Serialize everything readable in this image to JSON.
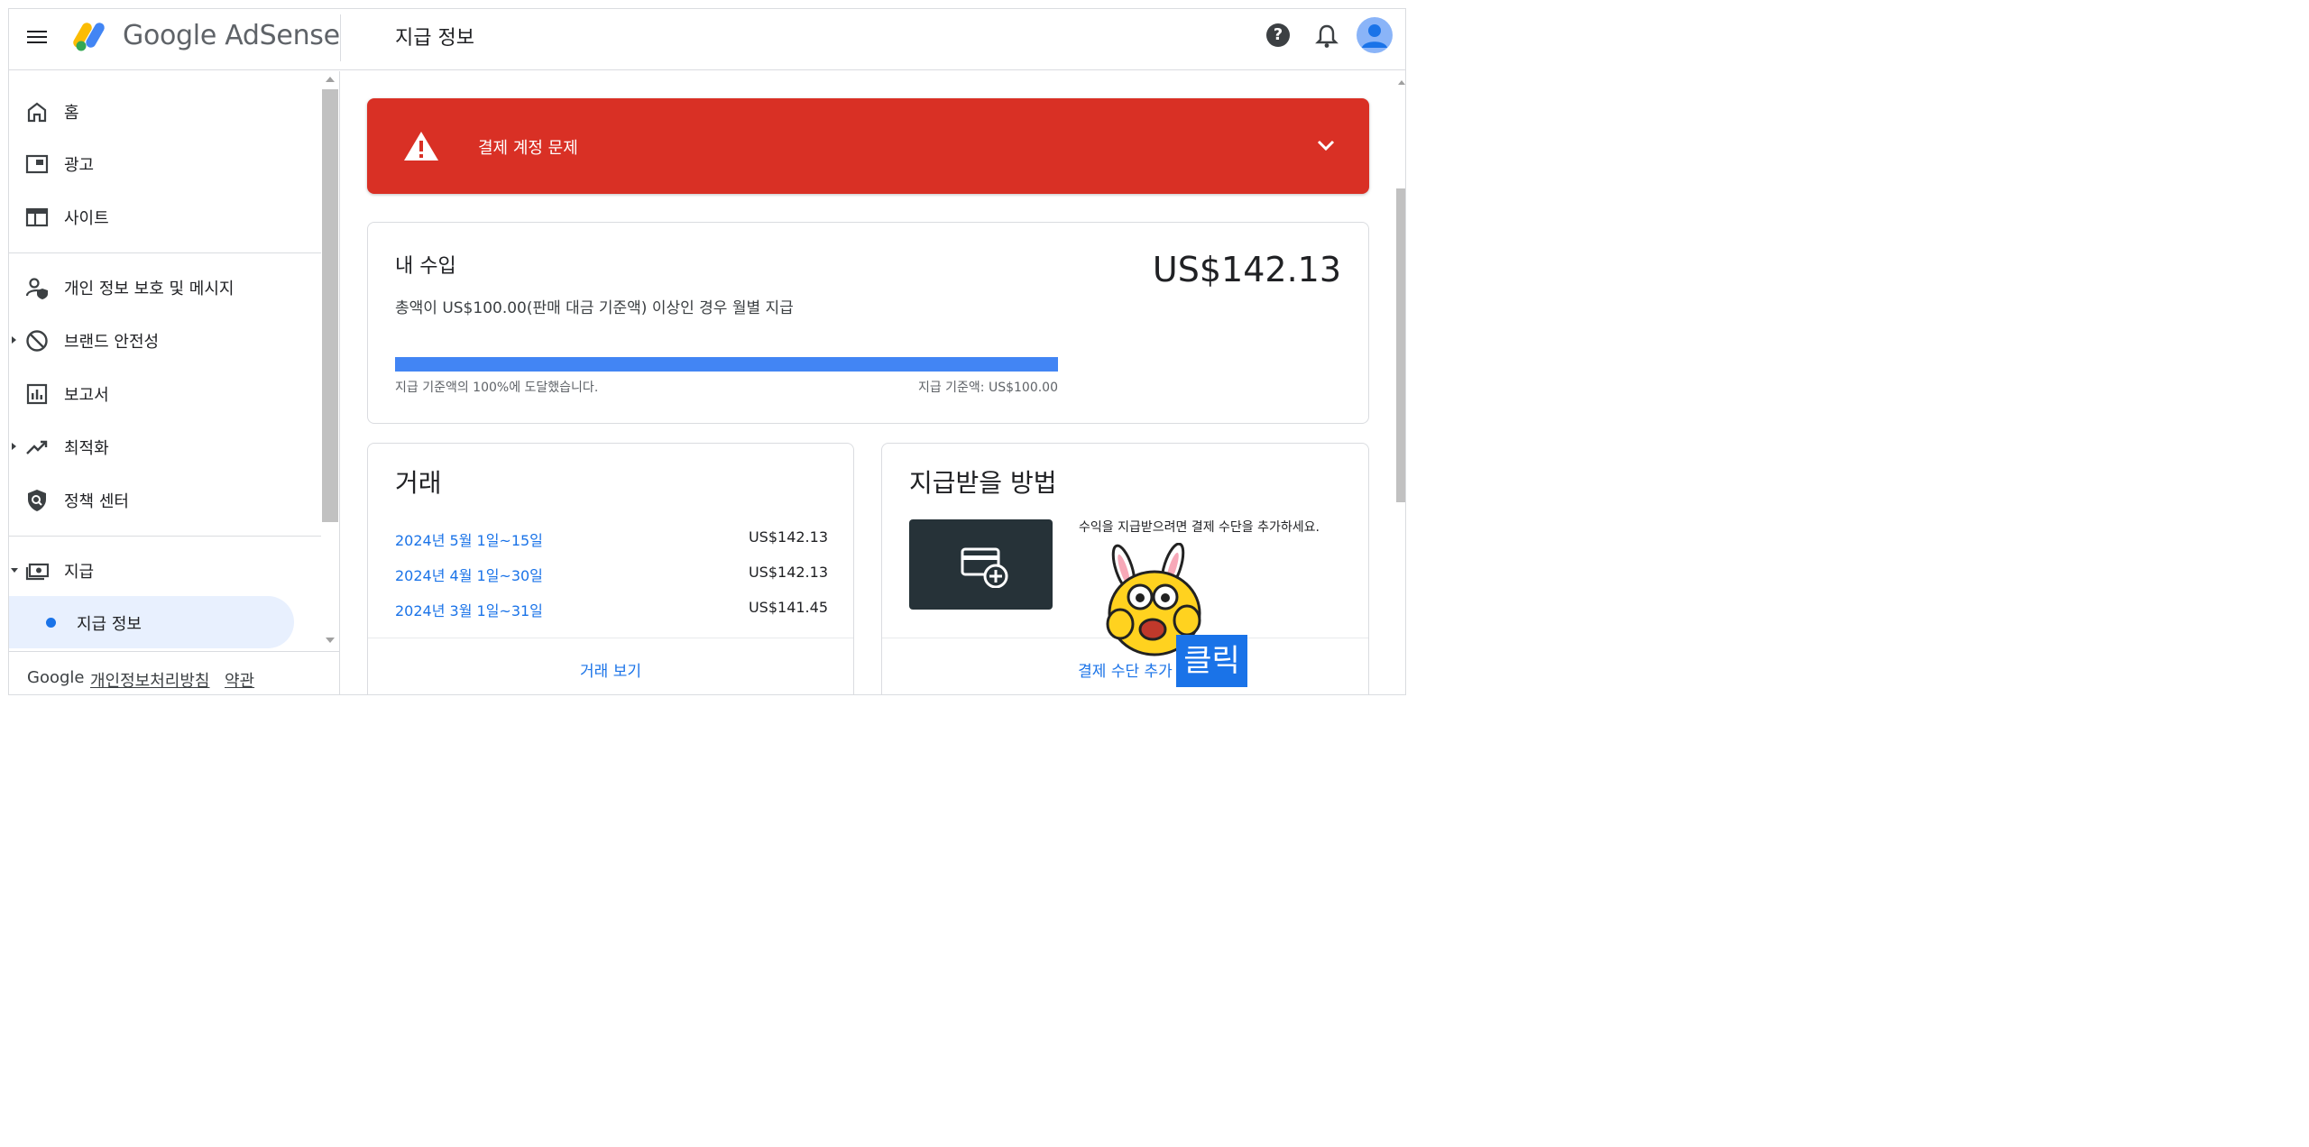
{
  "header": {
    "brand": "Google AdSense",
    "page_title": "지급 정보",
    "help_icon": "?"
  },
  "sidebar": {
    "items": [
      {
        "label": "홈",
        "icon": "home-icon"
      },
      {
        "label": "광고",
        "icon": "ads-icon"
      },
      {
        "label": "사이트",
        "icon": "sites-icon"
      },
      {
        "label": "개인 정보 보호 및 메시지",
        "icon": "privacy-icon"
      },
      {
        "label": "브랜드 안전성",
        "icon": "block-icon"
      },
      {
        "label": "보고서",
        "icon": "reports-icon"
      },
      {
        "label": "최적화",
        "icon": "trending-icon"
      },
      {
        "label": "정책 센터",
        "icon": "policy-icon"
      },
      {
        "label": "지급",
        "icon": "payments-icon"
      }
    ],
    "sub_item": "지급 정보",
    "footer": {
      "google": "Google",
      "privacy": "개인정보처리방침",
      "terms": "약관"
    }
  },
  "alert": {
    "text": "결제 계정 문제",
    "color": "#d93025"
  },
  "earnings": {
    "title": "내 수입",
    "subtitle": "총액이 US$100.00(판매 대금 기준액) 이상인 경우 월별 지급",
    "amount": "US$142.13",
    "progress_percent": 100,
    "progress_text": "지급 기준액의 100%에 도달했습니다.",
    "threshold_text": "지급 기준액: US$100.00"
  },
  "transactions": {
    "title": "거래",
    "rows": [
      {
        "date": "2024년 5월 1일~15일",
        "amount": "US$142.13"
      },
      {
        "date": "2024년 4월 1일~30일",
        "amount": "US$142.13"
      },
      {
        "date": "2024년 3월 1일~31일",
        "amount": "US$141.45"
      }
    ],
    "view_link": "거래 보기"
  },
  "payment": {
    "title": "지급받을 방법",
    "description": "수익을 지급받으려면 결제 수단을 추가하세요.",
    "add_link": "결제 수단 추가"
  },
  "overlay": {
    "click_label": "클릭"
  },
  "colors": {
    "accent": "#1a73e8",
    "progress": "#4285f4",
    "active_nav": "#e8f0fe"
  }
}
